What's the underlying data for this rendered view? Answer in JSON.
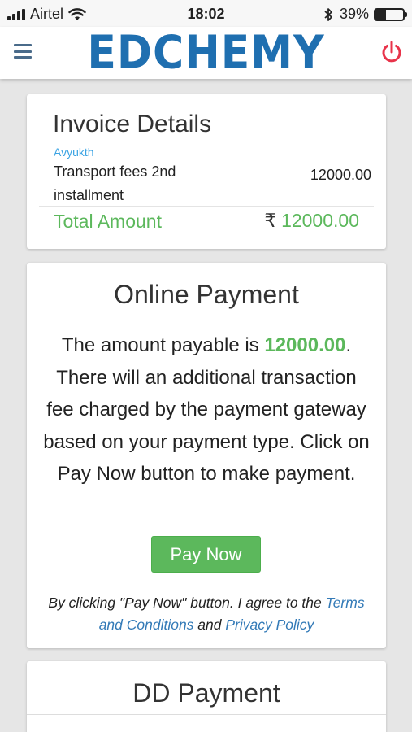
{
  "status_bar": {
    "carrier": "Airtel",
    "time": "18:02",
    "battery": "39%",
    "battery_level": 0.39
  },
  "header": {
    "logo": "EDCHEMY"
  },
  "invoice": {
    "title": "Invoice Details",
    "student": "Avyukth",
    "item_description": "Transport fees 2nd installment",
    "item_amount": "12000.00",
    "total_label": "Total Amount",
    "currency_symbol": "₹",
    "total_value": "12000.00"
  },
  "online_payment": {
    "title": "Online Payment",
    "text_before": "The amount payable is ",
    "amount": "12000.00",
    "text_after": ". There will an additional transaction fee charged by the payment gateway based on your payment type. Click on Pay Now button to make payment.",
    "button_label": "Pay Now",
    "terms_prefix": "By clicking \"Pay Now\" button. I agree to the ",
    "terms_link": "Terms and Conditions",
    "terms_and": " and ",
    "privacy_link": "Privacy Policy"
  },
  "dd_payment": {
    "title": "DD Payment"
  },
  "colors": {
    "brand": "#1f6fb0",
    "success": "#5cb85c",
    "link": "#337ab7",
    "student_name": "#3aa3e3",
    "power": "#e8334a"
  },
  "icons": [
    "signal-icon",
    "wifi-icon",
    "bluetooth-icon",
    "battery-icon",
    "menu-icon",
    "power-icon"
  ]
}
